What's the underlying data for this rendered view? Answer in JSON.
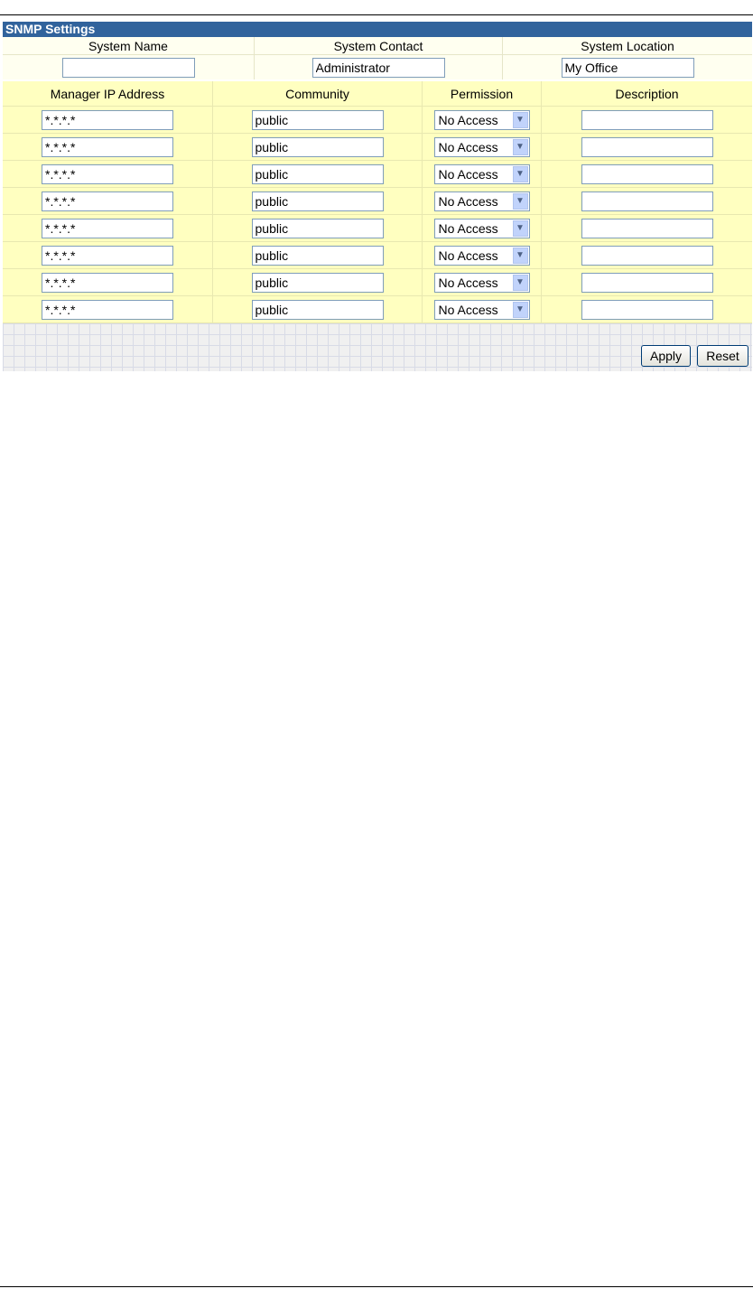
{
  "title": "SNMP Settings",
  "system": {
    "headers": [
      "System Name",
      "System Contact",
      "System Location"
    ],
    "name_value": "",
    "contact_value": "Administrator",
    "location_value": "My Office"
  },
  "managers": {
    "headers": [
      "Manager IP Address",
      "Community",
      "Permission",
      "Description"
    ],
    "rows": [
      {
        "ip": "*.*.*.*",
        "community": "public",
        "permission": "No Access",
        "description": ""
      },
      {
        "ip": "*.*.*.*",
        "community": "public",
        "permission": "No Access",
        "description": ""
      },
      {
        "ip": "*.*.*.*",
        "community": "public",
        "permission": "No Access",
        "description": ""
      },
      {
        "ip": "*.*.*.*",
        "community": "public",
        "permission": "No Access",
        "description": ""
      },
      {
        "ip": "*.*.*.*",
        "community": "public",
        "permission": "No Access",
        "description": ""
      },
      {
        "ip": "*.*.*.*",
        "community": "public",
        "permission": "No Access",
        "description": ""
      },
      {
        "ip": "*.*.*.*",
        "community": "public",
        "permission": "No Access",
        "description": ""
      },
      {
        "ip": "*.*.*.*",
        "community": "public",
        "permission": "No Access",
        "description": ""
      }
    ]
  },
  "buttons": {
    "apply": "Apply",
    "reset": "Reset"
  },
  "colors": {
    "title_bar": "#31639c",
    "table_bg": "#ffffc0",
    "header_bg": "#fffff0"
  }
}
